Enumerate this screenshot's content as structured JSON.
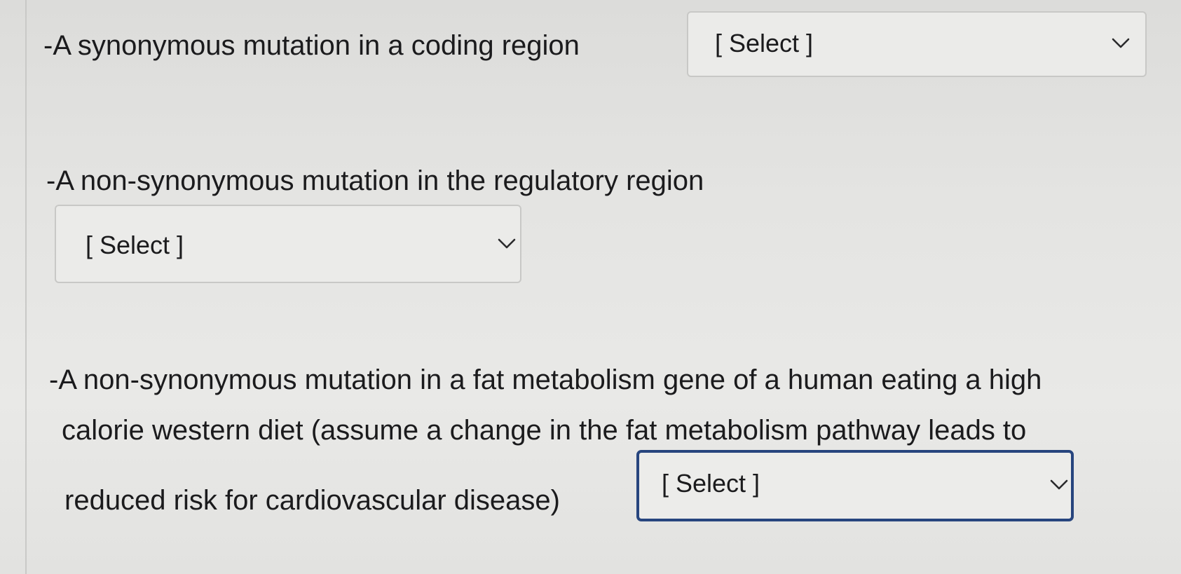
{
  "questions": [
    {
      "text": "-A synonymous mutation in a coding region",
      "select": {
        "value": "[ Select ]",
        "icon": "chevron-down-icon"
      }
    },
    {
      "text": "-A non-synonymous mutation in the regulatory region",
      "select": {
        "value": "[ Select ]",
        "icon": "chevron-down-icon"
      }
    },
    {
      "text_lines": [
        "-A non-synonymous mutation in a fat metabolism gene of a human eating a high",
        "calorie western diet (assume a change in the fat metabolism pathway leads to",
        "reduced risk for cardiovascular disease)"
      ],
      "select": {
        "value": "[ Select ]",
        "icon": "chevron-down-icon",
        "focused": true
      }
    }
  ],
  "colors": {
    "focus_border": "#27457e",
    "text": "#1b1b1d"
  }
}
